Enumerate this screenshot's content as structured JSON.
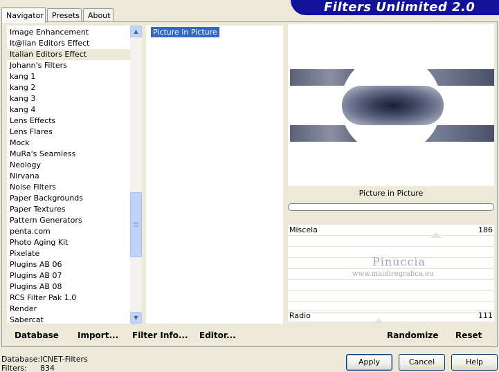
{
  "window": {
    "title": "Filters Unlimited 2.0"
  },
  "tabs": [
    "Navigator",
    "Presets",
    "About"
  ],
  "categories": [
    "Image Enhancement",
    "It@lian Editors Effect",
    "Italian Editors Effect",
    "Johann's Filters",
    "kang 1",
    "kang 2",
    "kang 3",
    "kang 4",
    "Lens Effects",
    "Lens Flares",
    "Mock",
    "MuRa's Seamless",
    "Neology",
    "Nirvana",
    "Noise Filters",
    "Paper Backgrounds",
    "Paper Textures",
    "Pattern Generators",
    "penta.com",
    "Photo Aging Kit",
    "Pixelate",
    "Plugins AB 06",
    "Plugins AB 07",
    "Plugins AB 08",
    "RCS Filter Pak 1.0",
    "Render",
    "Sabercat"
  ],
  "selected_category": "Italian Editors Effect",
  "filters": [
    "Picture in Picture"
  ],
  "preview": {
    "filter_name": "Picture in Picture"
  },
  "sliders": [
    {
      "name": "Miscela",
      "value": 186,
      "max": 255
    },
    {
      "name": "Radio",
      "value": 111,
      "max": 255
    }
  ],
  "watermark": {
    "name": "Pinuccia",
    "site": "www.maidiregrafica.eu"
  },
  "bottom_buttons": {
    "database": "Database",
    "import": "Import...",
    "filter_info": "Filter Info...",
    "editor": "Editor...",
    "randomize": "Randomize",
    "reset": "Reset"
  },
  "footer": {
    "database_label": "Database:",
    "database_value": "ICNET-Filters",
    "filters_label": "Filters:",
    "filters_value": "834"
  },
  "dialog_buttons": {
    "apply": "Apply",
    "cancel": "Cancel",
    "help": "Help"
  },
  "colors": {
    "banner": "#10129a",
    "selection": "#316ac5",
    "tab_accent": "#f0b83c"
  }
}
